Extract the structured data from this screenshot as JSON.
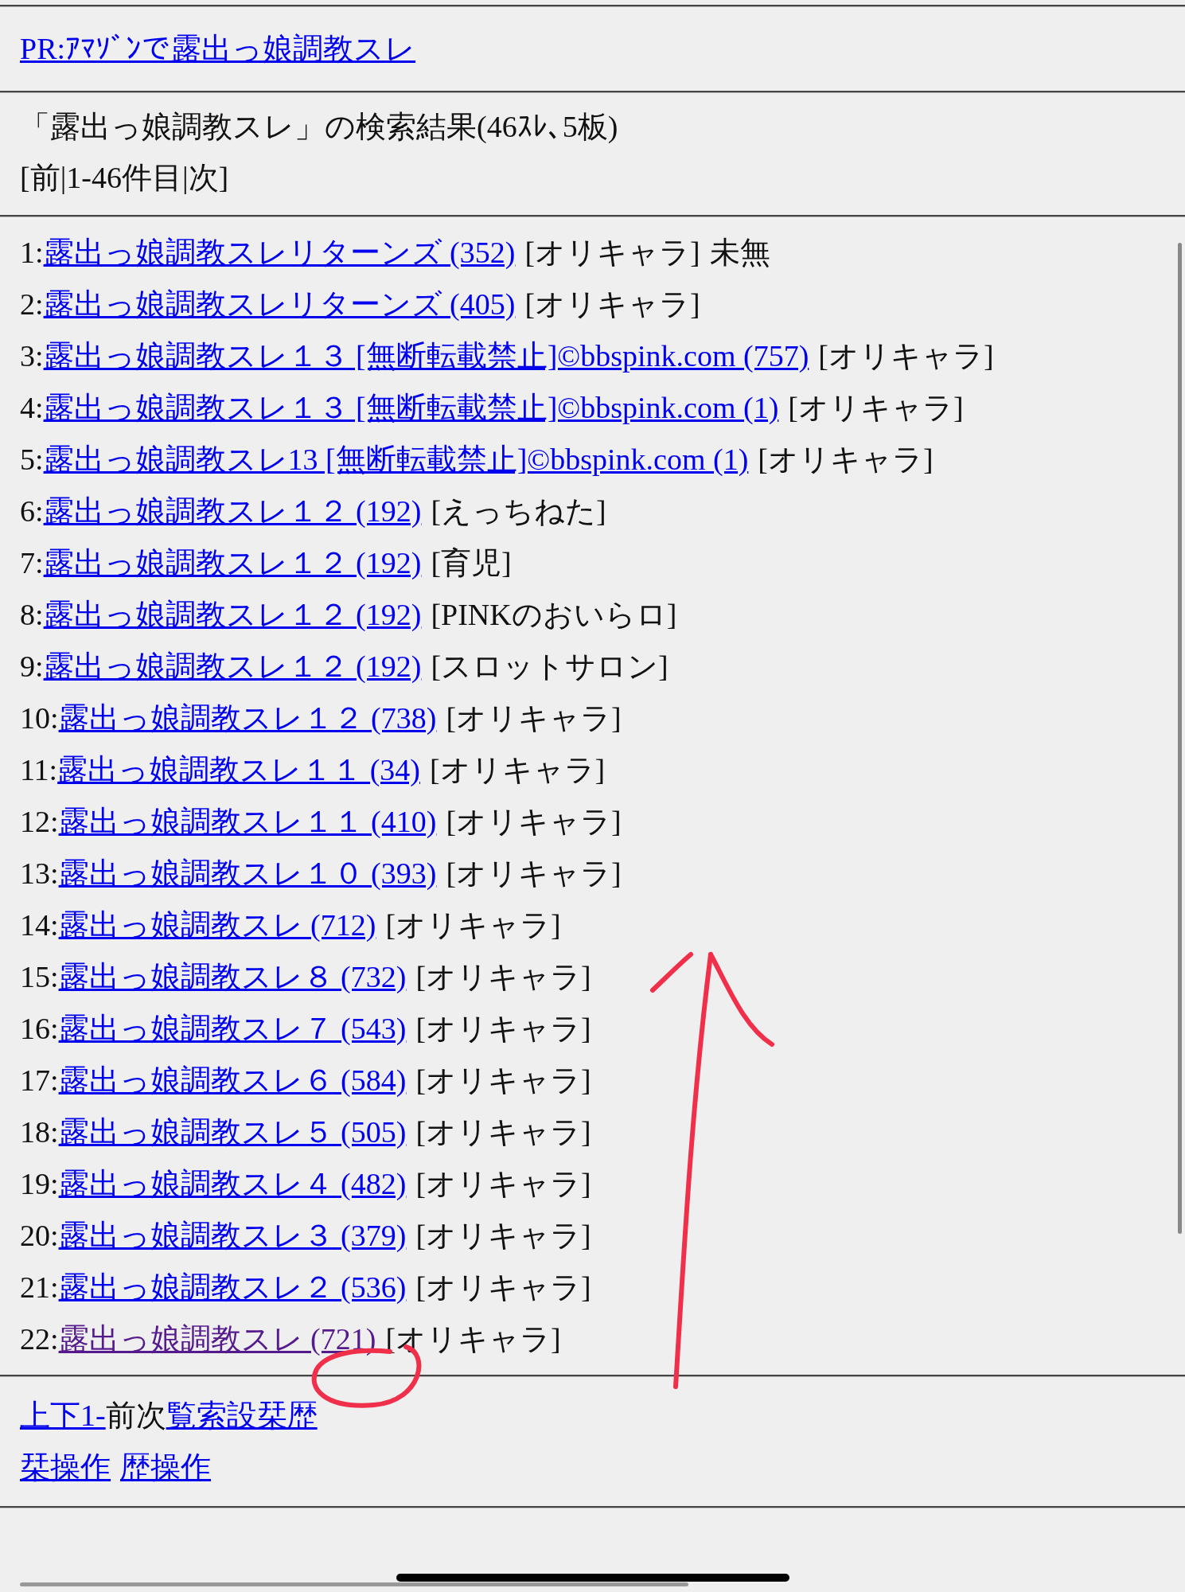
{
  "pr_link": "PR:ｱﾏｿﾞﾝで露出っ娘調教スレ",
  "search_summary": "「露出っ娘調教スレ」の検索結果(46ｽﾚ､5板)",
  "pager": "[前|1-46件目|次]",
  "results": [
    {
      "number": "1:",
      "link": "露出っ娘調教スレリターンズ (352)",
      "board": "[オリキャラ]",
      "note": "未無",
      "visited": false
    },
    {
      "number": "2:",
      "link": "露出っ娘調教スレリターンズ (405)",
      "board": "[オリキャラ]",
      "visited": false
    },
    {
      "number": "3:",
      "link": "露出っ娘調教スレ１３ [無断転載禁止]©bbspink.com (757)",
      "board": "[オリキャラ]",
      "visited": false
    },
    {
      "number": "4:",
      "link": "露出っ娘調教スレ１３ [無断転載禁止]©bbspink.com (1)",
      "board": "[オリキャラ]",
      "visited": false
    },
    {
      "number": "5:",
      "link": "露出っ娘調教スレ13 [無断転載禁止]©bbspink.com (1)",
      "board": "[オリキャラ]",
      "visited": false
    },
    {
      "number": "6:",
      "link": "露出っ娘調教スレ１２ (192)",
      "board": "[えっちねた]",
      "visited": false
    },
    {
      "number": "7:",
      "link": "露出っ娘調教スレ１２ (192)",
      "board": "[育児]",
      "visited": false
    },
    {
      "number": "8:",
      "link": "露出っ娘調教スレ１２ (192)",
      "board": "[PINKのおいらロ]",
      "visited": false
    },
    {
      "number": "9:",
      "link": "露出っ娘調教スレ１２ (192)",
      "board": "[スロットサロン]",
      "visited": false
    },
    {
      "number": "10:",
      "link": "露出っ娘調教スレ１２ (738)",
      "board": "[オリキャラ]",
      "visited": false
    },
    {
      "number": "11:",
      "link": "露出っ娘調教スレ１１ (34)",
      "board": "[オリキャラ]",
      "visited": false
    },
    {
      "number": "12:",
      "link": "露出っ娘調教スレ１１ (410)",
      "board": "[オリキャラ]",
      "visited": false
    },
    {
      "number": "13:",
      "link": "露出っ娘調教スレ１０ (393)",
      "board": "[オリキャラ]",
      "visited": false
    },
    {
      "number": "14:",
      "link": "露出っ娘調教スレ (712)",
      "board": "[オリキャラ]",
      "visited": false
    },
    {
      "number": "15:",
      "link": "露出っ娘調教スレ８ (732)",
      "board": "[オリキャラ]",
      "visited": false
    },
    {
      "number": "16:",
      "link": "露出っ娘調教スレ７ (543)",
      "board": "[オリキャラ]",
      "visited": false
    },
    {
      "number": "17:",
      "link": "露出っ娘調教スレ６ (584)",
      "board": "[オリキャラ]",
      "visited": false
    },
    {
      "number": "18:",
      "link": "露出っ娘調教スレ５ (505)",
      "board": "[オリキャラ]",
      "visited": false
    },
    {
      "number": "19:",
      "link": "露出っ娘調教スレ４ (482)",
      "board": "[オリキャラ]",
      "visited": false
    },
    {
      "number": "20:",
      "link": "露出っ娘調教スレ３ (379)",
      "board": "[オリキャラ]",
      "visited": false
    },
    {
      "number": "21:",
      "link": "露出っ娘調教スレ２ (536)",
      "board": "[オリキャラ]",
      "visited": false
    },
    {
      "number": "22:",
      "link": "露出っ娘調教スレ (721)",
      "board": "[オリキャラ]",
      "visited": true
    }
  ],
  "footer_lines": [
    [
      {
        "kind": "link",
        "text": "上下1-"
      },
      {
        "kind": "text",
        "text": "前次"
      },
      {
        "kind": "link",
        "text": "覧索設栞歴"
      }
    ],
    [
      {
        "kind": "link",
        "text": "栞操作"
      },
      {
        "kind": "space"
      },
      {
        "kind": "link",
        "text": "歴操作"
      }
    ]
  ]
}
